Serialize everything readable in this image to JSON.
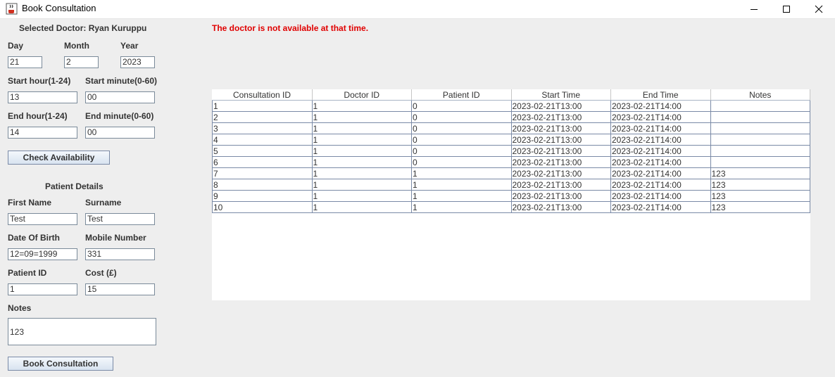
{
  "window": {
    "title": "Book Consultation",
    "icon": "java-coffee-cup-icon",
    "controls": [
      "minimize-icon",
      "maximize-icon",
      "close-icon"
    ]
  },
  "form": {
    "selected_doctor": "Selected Doctor: Ryan Kuruppu",
    "day_label": "Day",
    "day_value": "21",
    "month_label": "Month",
    "month_value": "2",
    "year_label": "Year",
    "year_value": "2023",
    "start_hour_label": "Start hour(1-24)",
    "start_hour_value": "13",
    "start_minute_label": "Start minute(0-60)",
    "start_minute_value": "00",
    "end_hour_label": "End hour(1-24)",
    "end_hour_value": "14",
    "end_minute_label": "End minute(0-60)",
    "end_minute_value": "00",
    "check_button": "Check Availability",
    "patient_details_heading": "Patient Details",
    "first_name_label": "First Name",
    "first_name_value": "Test",
    "surname_label": "Surname",
    "surname_value": "Test",
    "dob_label": "Date Of Birth",
    "dob_value": "12=09=1999",
    "mobile_label": "Mobile Number",
    "mobile_value": "331",
    "patient_id_label": "Patient ID",
    "patient_id_value": "1",
    "cost_label": "Cost (£)",
    "cost_value": "15",
    "notes_label": "Notes",
    "notes_value": "123",
    "book_button": "Book Consultation"
  },
  "status_message": "The doctor is not available at that time.",
  "colors": {
    "error": "#e00000",
    "background": "#eeeeee"
  },
  "table": {
    "headers": [
      "Consultation ID",
      "Doctor ID",
      "Patient ID",
      "Start Time",
      "End Time",
      "Notes"
    ],
    "rows": [
      [
        "1",
        "1",
        "0",
        "2023-02-21T13:00",
        "2023-02-21T14:00",
        ""
      ],
      [
        "2",
        "1",
        "0",
        "2023-02-21T13:00",
        "2023-02-21T14:00",
        ""
      ],
      [
        "3",
        "1",
        "0",
        "2023-02-21T13:00",
        "2023-02-21T14:00",
        ""
      ],
      [
        "4",
        "1",
        "0",
        "2023-02-21T13:00",
        "2023-02-21T14:00",
        ""
      ],
      [
        "5",
        "1",
        "0",
        "2023-02-21T13:00",
        "2023-02-21T14:00",
        ""
      ],
      [
        "6",
        "1",
        "0",
        "2023-02-21T13:00",
        "2023-02-21T14:00",
        ""
      ],
      [
        "7",
        "1",
        "1",
        "2023-02-21T13:00",
        "2023-02-21T14:00",
        "123"
      ],
      [
        "8",
        "1",
        "1",
        "2023-02-21T13:00",
        "2023-02-21T14:00",
        "123"
      ],
      [
        "9",
        "1",
        "1",
        "2023-02-21T13:00",
        "2023-02-21T14:00",
        "123"
      ],
      [
        "10",
        "1",
        "1",
        "2023-02-21T13:00",
        "2023-02-21T14:00",
        "123"
      ]
    ]
  }
}
